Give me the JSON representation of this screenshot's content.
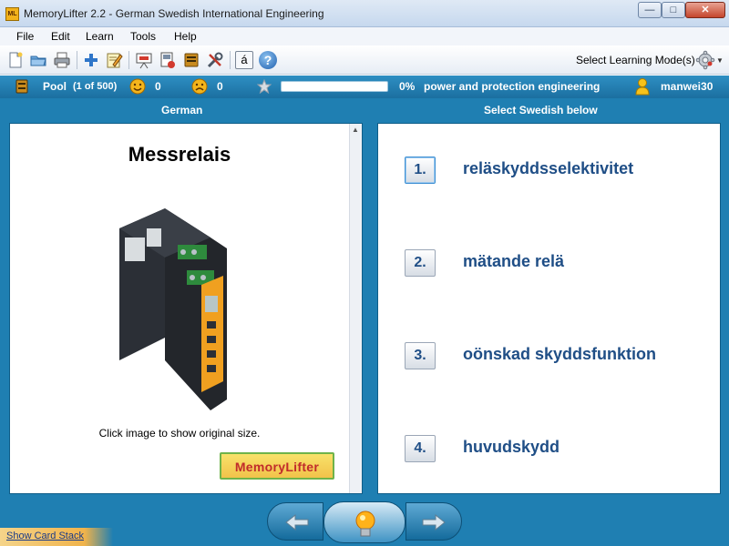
{
  "window": {
    "app_icon_text": "ML",
    "title": "MemoryLifter 2.2 - German Swedish International Engineering",
    "minimize_symbol": "—",
    "maximize_symbol": "□",
    "close_symbol": "✕"
  },
  "menu": {
    "items": [
      "File",
      "Edit",
      "Learn",
      "Tools",
      "Help"
    ]
  },
  "toolbar": {
    "icons": [
      "new-document-icon",
      "open-folder-icon",
      "print-icon",
      "add-card-icon",
      "edit-card-icon",
      "slideshow-icon",
      "card-stack-icon",
      "statistics-icon",
      "settings-tools-icon",
      "special-char-icon",
      "help-icon"
    ],
    "special_char_label": "á",
    "help_label": "?",
    "learning_mode_label": "Select Learning Mode(s)"
  },
  "status": {
    "pool_label": "Pool",
    "pool_count": "(1 of 500)",
    "correct_count": "0",
    "wrong_count": "0",
    "progress": 0,
    "progress_percent": "0%",
    "chapter": "power and protection engineering",
    "user": "manwei30"
  },
  "question": {
    "column_header": "German",
    "word": "Messrelais",
    "image_hint": "Click image to show original size.",
    "logo_text": "MemoryLifter"
  },
  "answers": {
    "column_header": "Select Swedish below",
    "options": [
      {
        "number": "1.",
        "text": "reläskyddsselektivitet"
      },
      {
        "number": "2.",
        "text": "mätande relä"
      },
      {
        "number": "3.",
        "text": "oönskad skyddsfunktion"
      },
      {
        "number": "4.",
        "text": "huvudskydd"
      }
    ]
  },
  "footer": {
    "show_card_stack": "Show Card Stack"
  },
  "colors": {
    "accent_blue": "#1f7fb2",
    "answer_text": "#1f4e86"
  }
}
